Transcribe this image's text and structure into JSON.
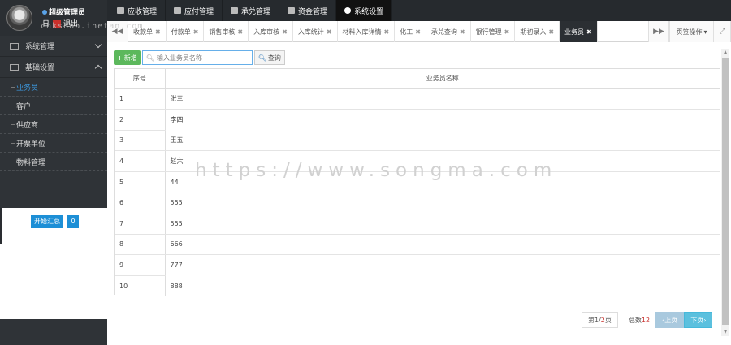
{
  "profile": {
    "role": "超级管理员",
    "actions": [
      "日",
      "退出"
    ]
  },
  "watermark_top": "cnkshop.inetan.com",
  "watermark": "https://www.songma.com",
  "modules": [
    {
      "label": "应收管理",
      "icon": "grid-icon"
    },
    {
      "label": "应付管理",
      "icon": "grid-icon"
    },
    {
      "label": "承兑管理",
      "icon": "grid-icon"
    },
    {
      "label": "资金管理",
      "icon": "grid-icon"
    },
    {
      "label": "系统设置",
      "icon": "gear-icon",
      "active": true
    }
  ],
  "sidebar": {
    "sections": [
      {
        "label": "系统管理",
        "icon": "edit-icon"
      },
      {
        "label": "基础设置",
        "icon": "monitor-icon"
      }
    ],
    "items": [
      {
        "label": "业务员",
        "active": true
      },
      {
        "label": "客户"
      },
      {
        "label": "供应商"
      },
      {
        "label": "开票单位"
      },
      {
        "label": "物料管理"
      }
    ],
    "start_button": "开始汇总",
    "count_button": "0"
  },
  "page_tabs": [
    "收款单",
    "付款单",
    "销售审核",
    "入库审核",
    "入库统计",
    "材料入库详情",
    "化工",
    "承兑查询",
    "银行管理",
    "期初录入",
    "业务员"
  ],
  "active_tab_index": 10,
  "tab_ops_label": "页签操作",
  "toolbar": {
    "add_label": "新增",
    "search_placeholder": "输入业务员名称",
    "query_label": "查询"
  },
  "table": {
    "headers": [
      "序号",
      "业务员名称"
    ],
    "rows": [
      [
        "1",
        "张三"
      ],
      [
        "2",
        "李四"
      ],
      [
        "3",
        "王五"
      ],
      [
        "4",
        "赵六"
      ],
      [
        "5",
        "44"
      ],
      [
        "6",
        "555"
      ],
      [
        "7",
        "555"
      ],
      [
        "8",
        "666"
      ],
      [
        "9",
        "777"
      ],
      [
        "10",
        "888"
      ]
    ]
  },
  "pager": {
    "page_prefix": "第",
    "page_current": "1",
    "page_sep": "/",
    "page_total": "2",
    "page_suffix": "页",
    "count_prefix": "总数",
    "count_value": "12",
    "prev_label": "‹上页",
    "next_label": "下页›"
  }
}
